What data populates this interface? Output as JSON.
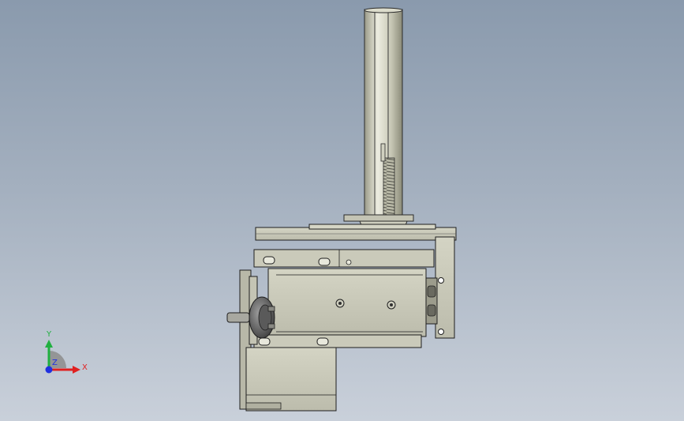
{
  "viewport": {
    "background_top": "#8a9aad",
    "background_bottom": "#c9d0da",
    "part_body_color": "#c8c8b8",
    "part_edge_color": "#1e1e1e",
    "shaft_color": "#d6d6c4"
  },
  "triad": {
    "x_label": "X",
    "y_label": "Y",
    "z_label": "Z",
    "x_color": "#e02020",
    "y_color": "#20b040",
    "z_color": "#2030e0"
  }
}
